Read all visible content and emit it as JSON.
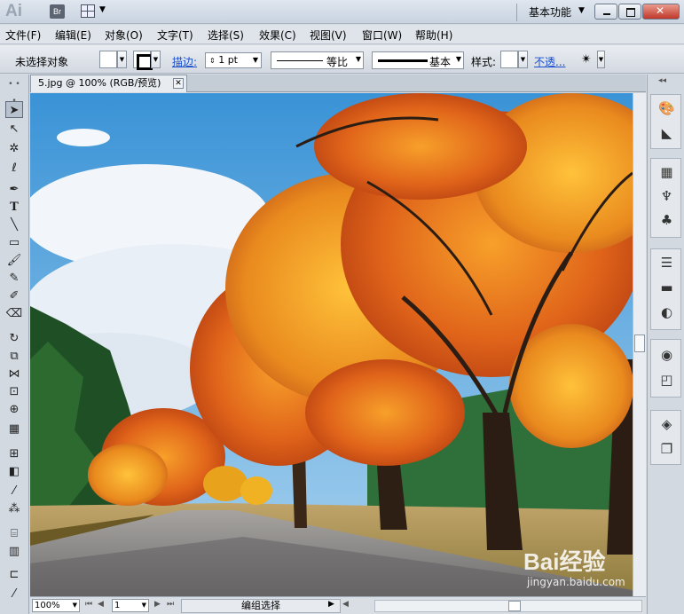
{
  "app": {
    "logo": "Ai",
    "bridge_label": "Br",
    "workspace": "基本功能"
  },
  "menu": [
    "文件(F)",
    "编辑(E)",
    "对象(O)",
    "文字(T)",
    "选择(S)",
    "效果(C)",
    "视图(V)",
    "窗口(W)",
    "帮助(H)"
  ],
  "control": {
    "selection_status": "未选择对象",
    "stroke_label": "描边:",
    "stroke_weight": "1 pt",
    "profile_label": "等比",
    "brush_label": "基本",
    "style_label": "样式:",
    "opacity_label": "不透..."
  },
  "document": {
    "tab_title": "5.jpg @ 100% (RGB/预览)",
    "tab_close": "✕"
  },
  "status": {
    "zoom": "100%",
    "page": "1",
    "tool_status": "编组选择"
  },
  "watermark": {
    "brand": "Bai经验",
    "url": "jingyan.baidu.com"
  }
}
